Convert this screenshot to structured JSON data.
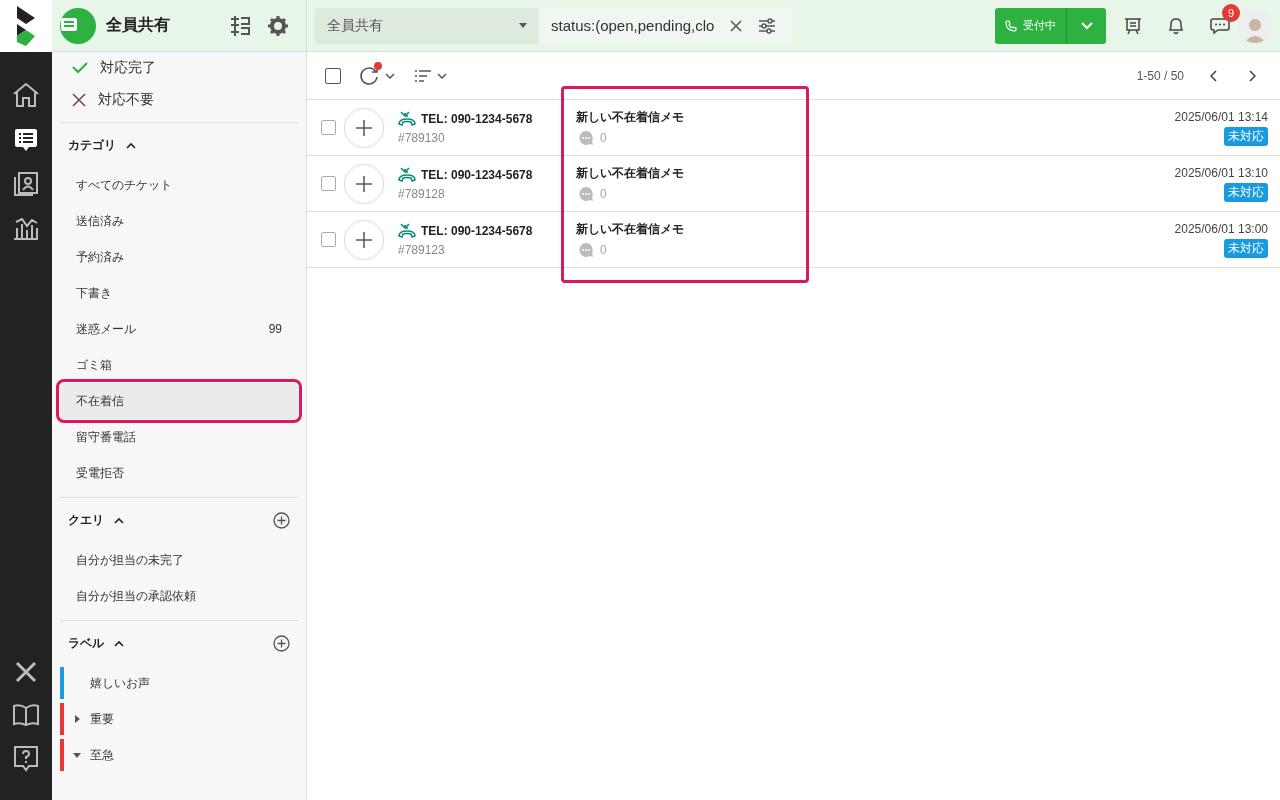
{
  "header": {
    "title": "全員共有",
    "view_select": "全員共有",
    "search_query": "status:(open,pending,clo",
    "status_button": "受付中",
    "chat_badge": "9"
  },
  "sidebar": {
    "status_items": [
      {
        "label": "対応完了",
        "kind": "check"
      },
      {
        "label": "対応不要",
        "kind": "cross"
      }
    ],
    "categories": {
      "title": "カテゴリ",
      "expanded": true,
      "items": [
        {
          "label": "すべてのチケット",
          "selected": false,
          "highlighted": false
        },
        {
          "label": "送信済み",
          "selected": false,
          "highlighted": false
        },
        {
          "label": "予約済み",
          "selected": false,
          "highlighted": false
        },
        {
          "label": "下書き",
          "selected": false,
          "highlighted": false
        },
        {
          "label": "迷惑メール",
          "count": "99",
          "selected": false,
          "highlighted": false
        },
        {
          "label": "ゴミ箱",
          "selected": false,
          "highlighted": false
        },
        {
          "label": "不在着信",
          "selected": true,
          "highlighted": true
        },
        {
          "label": "留守番電話",
          "selected": false,
          "highlighted": false
        },
        {
          "label": "受電拒否",
          "selected": false,
          "highlighted": false
        }
      ]
    },
    "queries": {
      "title": "クエリ",
      "expanded": true,
      "items": [
        {
          "label": "自分が担当の未完了",
          "selected": false,
          "highlighted": false
        },
        {
          "label": "自分が担当の承認依頼",
          "selected": false,
          "highlighted": false
        }
      ]
    },
    "labels": {
      "title": "ラベル",
      "expanded": true,
      "items": [
        {
          "label": "嬉しいお声",
          "color": "#1a9be0",
          "kind": "leaf"
        },
        {
          "label": "重要",
          "color": "#e53935",
          "kind": "collapsed"
        },
        {
          "label": "至急",
          "color": "#e53935",
          "kind": "expanded"
        }
      ]
    }
  },
  "toolbar": {
    "pagination": "1-50 / 50",
    "select_all_checked": false
  },
  "tickets": [
    {
      "phone": "TEL: 090-1234-5678",
      "number": "#789130",
      "subject": "新しい不在着信メモ",
      "comments": "0",
      "datetime": "2025/06/01 13:14",
      "status": "未対応",
      "checked": false
    },
    {
      "phone": "TEL: 090-1234-5678",
      "number": "#789128",
      "subject": "新しい不在着信メモ",
      "comments": "0",
      "datetime": "2025/06/01 13:10",
      "status": "未対応",
      "checked": false
    },
    {
      "phone": "TEL: 090-1234-5678",
      "number": "#789123",
      "subject": "新しい不在着信メモ",
      "comments": "0",
      "datetime": "2025/06/01 13:00",
      "status": "未対応",
      "checked": false
    }
  ],
  "subject_highlighted": true
}
